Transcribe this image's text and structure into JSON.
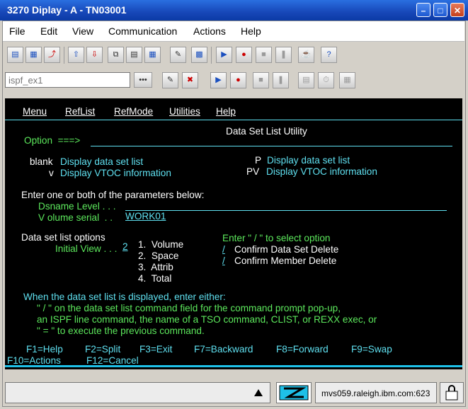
{
  "window": {
    "title": "3270 Diplay - A - TN03001"
  },
  "menubar": {
    "items": [
      "File",
      "Edit",
      "View",
      "Communication",
      "Actions",
      "Help"
    ]
  },
  "toolbar": {
    "session_value": "ispf_ex1",
    "more_label": "•••"
  },
  "ispf": {
    "menu": [
      "Menu",
      "RefList",
      "RefMode",
      "Utilities",
      "Help"
    ],
    "panel_title": "Data Set List Utility",
    "option_label": "Option  ===>",
    "options": {
      "blank_key": "blank",
      "blank_text": "Display data set list",
      "v_key": "v",
      "v_text": "Display VTOC information",
      "p_key": "P",
      "p_text": "Display data set list",
      "pv_key": "PV",
      "pv_text": "Display VTOC information"
    },
    "params_heading": "Enter one or both of the parameters below:",
    "dsname_label": "Dsname Level . . .",
    "volume_label": "V olume serial  . .",
    "volume_value": "WORK01",
    "dsl_options_label": "Data set list options",
    "initial_view_label": "Initial View . . .",
    "initial_view_value": "2",
    "views": [
      "1.  Volume",
      "2.  Space",
      "3.  Attrib",
      "4.  Total"
    ],
    "select_prompt": "Enter \" / \" to select option",
    "confirm_marker": "/",
    "confirm_ds": "Confirm Data Set Delete",
    "confirm_member": "Confirm Member Delete",
    "help_line1": "When the data set list is displayed, enter either:",
    "help_line2": "\" / \" on the data set list command field for the command prompt pop-up,",
    "help_line3": "an ISPF line command, the name of a TSO command, CLIST, or REXX exec, or",
    "help_line4": "\" = \" to execute the previous command.",
    "fkeys1": [
      "F1=Help",
      "F2=Split",
      "F3=Exit",
      "F7=Backward",
      "F8=Forward",
      "F9=Swap"
    ],
    "fkeys2": [
      "F10=Actions",
      "F12=Cancel"
    ]
  },
  "status": {
    "host": "mvs059.raleigh.ibm.com:623"
  },
  "colors": {
    "terminal_bg": "#000000",
    "cyan": "#5fe0f0",
    "green": "#5ce85c",
    "title_blue": "#1747b8"
  }
}
